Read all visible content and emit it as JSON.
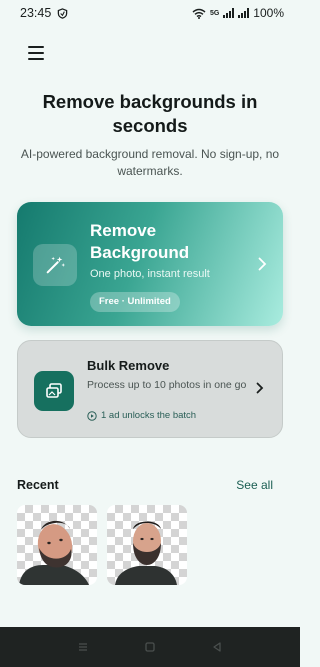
{
  "status_bar": {
    "time": "23:45",
    "battery": "100%",
    "network_label": "5G"
  },
  "hero": {
    "title": "Remove backgrounds in seconds",
    "subtitle": "AI-powered background removal. No sign-up, no watermarks."
  },
  "primary_card": {
    "title": "Remove Background",
    "subtitle": "One photo, instant result",
    "badge": "Free · Unlimited",
    "icon": "magic-wand-icon"
  },
  "secondary_card": {
    "title": "Bulk Remove",
    "description": "Process up to 10 photos in one go",
    "ad_note": "1 ad unlocks the batch",
    "icon": "stacked-photos-icon"
  },
  "recent": {
    "label": "Recent",
    "see_all": "See all",
    "items": [
      "recent-photo-1",
      "recent-photo-2"
    ]
  },
  "colors": {
    "accent": "#157a6e",
    "accent_light": "#a9ecdf",
    "background": "#f1f8f6"
  }
}
